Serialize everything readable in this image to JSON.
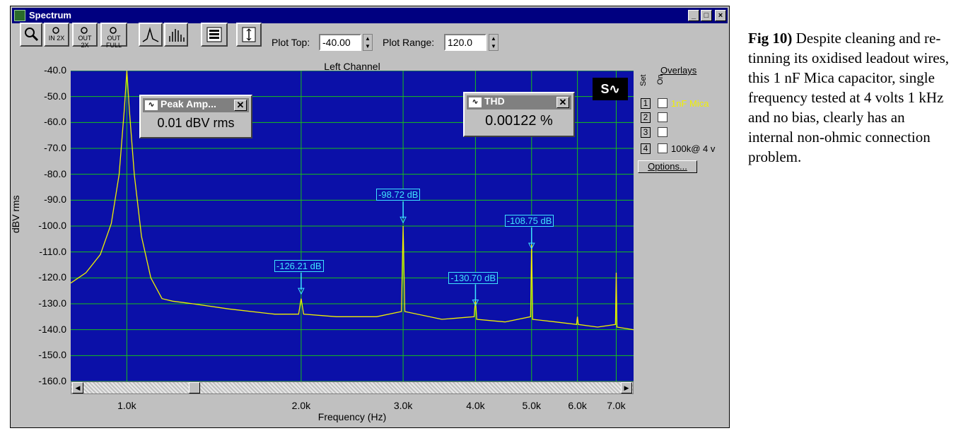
{
  "window": {
    "title": "Spectrum"
  },
  "toolbar": {
    "zoom_in_label": "IN 2X",
    "zoom_out_label": "OUT 2X",
    "zoom_full_label": "OUT FULL",
    "plot_top_label": "Plot Top:",
    "plot_top_value": "-40.00",
    "plot_range_label": "Plot Range:",
    "plot_range_value": "120.0"
  },
  "plot": {
    "title": "Left Channel",
    "ylabel": "dBV rms",
    "xlabel": "Frequency (Hz)",
    "yticks": [
      "-40.0",
      "-50.0",
      "-60.0",
      "-70.0",
      "-80.0",
      "-90.0",
      "-100.0",
      "-110.0",
      "-120.0",
      "-130.0",
      "-140.0",
      "-150.0",
      "-160.0"
    ],
    "xticks": [
      "1.0k",
      "2.0k",
      "3.0k",
      "4.0k",
      "5.0k",
      "6.0k",
      "7.0k"
    ],
    "peak_labels": [
      "-126.21 dB",
      "-98.72 dB",
      "-130.70 dB",
      "-108.75 dB"
    ]
  },
  "peak_amp": {
    "title": "Peak Amp...",
    "value": "0.01 dBV rms"
  },
  "thd": {
    "title": "THD",
    "value": "0.00122 %"
  },
  "overlays": {
    "title": "Overlays",
    "col_set": "Set",
    "col_on": "On",
    "rows": [
      {
        "num": "1",
        "name": "1nF Mica"
      },
      {
        "num": "2",
        "name": ""
      },
      {
        "num": "3",
        "name": ""
      },
      {
        "num": "4",
        "name": "100k@ 4 v"
      }
    ],
    "options_label": "Options..."
  },
  "caption": {
    "lead": "Fig 10)",
    "text": " Despite cleaning and re-tinning its oxidised leadout wires, this 1 nF Mica capacitor, single frequency tested at 4 volts 1 kHz and no bias, clearly has an internal non-ohmic connection problem."
  },
  "colors": {
    "plot_bg": "#0b10a8",
    "grid": "#18c018",
    "trace": "#f0f000",
    "marker": "#3fe4ff",
    "titlebar": "#000080"
  },
  "chart_data": {
    "type": "line",
    "title": "Left Channel",
    "xlabel": "Frequency (Hz)",
    "ylabel": "dBV rms",
    "ylim": [
      -160,
      -40
    ],
    "xscale": "log",
    "xlim": [
      800,
      7500
    ],
    "grid": true,
    "series": [
      {
        "name": "1nF Mica",
        "x": [
          800,
          850,
          900,
          940,
          970,
          990,
          1000,
          1010,
          1030,
          1060,
          1100,
          1150,
          1200,
          1300,
          1500,
          1800,
          1980,
          2000,
          2020,
          2300,
          2700,
          2980,
          3000,
          3020,
          3500,
          3980,
          4000,
          4020,
          4500,
          4980,
          5000,
          5020,
          5500,
          5980,
          6000,
          6020,
          6500,
          6980,
          7000,
          7020,
          7500
        ],
        "y": [
          -122,
          -118,
          -111,
          -99,
          -80,
          -55,
          -40,
          -55,
          -80,
          -104,
          -120,
          -128,
          -129,
          -130,
          -132,
          -134,
          -134,
          -128,
          -134,
          -135,
          -135,
          -133,
          -100,
          -133,
          -136,
          -135,
          -128,
          -136,
          -137,
          -135,
          -105,
          -136,
          -137,
          -138,
          -135,
          -138,
          -139,
          -138,
          -118,
          -139,
          -140
        ]
      }
    ],
    "annotations": [
      {
        "x": 2000,
        "y": -126.21,
        "text": "-126.21 dB"
      },
      {
        "x": 3000,
        "y": -98.72,
        "text": "-98.72 dB"
      },
      {
        "x": 4000,
        "y": -130.7,
        "text": "-130.70 dB"
      },
      {
        "x": 5000,
        "y": -108.75,
        "text": "-108.75 dB"
      }
    ]
  }
}
